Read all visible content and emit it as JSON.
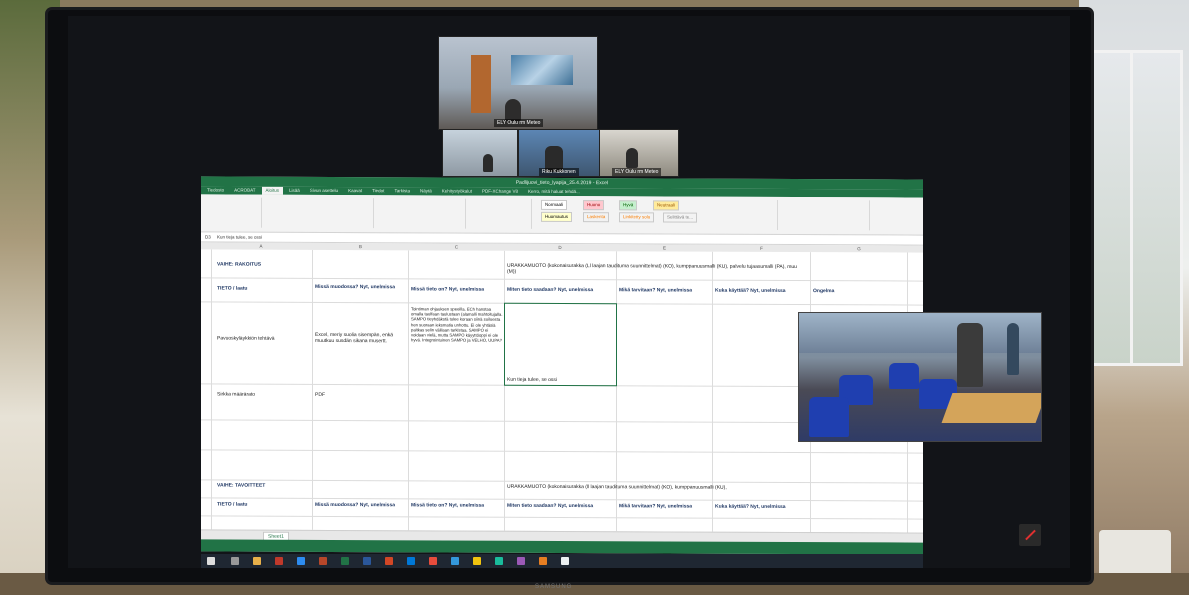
{
  "video_call": {
    "main_caption": "ELY Oulu rm Meteo",
    "tile_b_caption": "Riku Kukkonen",
    "tile_c_caption": "ELY Oulu rm Meteo"
  },
  "excel": {
    "window_title": "Padlijuovi_tieto_lyapija_25.4.2019 - Excel",
    "tabs": [
      "Tiedosto",
      "ACROBAT",
      "Aloitus",
      "Lisää",
      "Sivun asettelu",
      "Kaavat",
      "Tiedot",
      "Tarkista",
      "Näytä",
      "Kehitystyökalut",
      "PDF-XChange V8",
      "Kerro, mitä haluat tehdä..."
    ],
    "active_tab_index": 2,
    "styles": [
      "Normaali",
      "Huono",
      "Hyvä",
      "Neutraali",
      "Huomautus",
      "Laskenta",
      "Linkitetty solu",
      "Selittävä te..."
    ],
    "name_box": "D3",
    "formula": "Kun tieja tulee, se ossi",
    "columns": [
      "A",
      "B",
      "C",
      "D",
      "E",
      "F",
      "G"
    ],
    "section1_title": "VAIHE: RAKOITUS",
    "section1_note": "URAKKAMUOTO (kokonaisurakka (Ll laajan taudituma suunnittelmat) (KO), kumppanuusmalli (KU), palvelu tujaasumalli (PA), muu (M))",
    "headers": [
      "TIETO / laatu",
      "Missä muodossa? Nyt, unelmissa",
      "Missä tieto on? Nyt, unelmissa",
      "Miten tieto saadaan? Nyt, unelmissa",
      "Mikä tarvitaan? Nyt, unelmissa",
      "Kuka käyttää? Nyt, unelmissa",
      "Ongelma"
    ],
    "row3_a": "Pavuoskyläykkiön tehtävä",
    "row3_b": "Excel, meriy suolia sisempän, enkä muutkuu susdän sikana musertt.",
    "row3_c": "Tointiman ohjauksen speeilla. ECh hanstaa omalla taulfaan taulustaan (alamalli mahtoitujalla. SAMPO tieyhdäkstä tulee koraan siinä suiluesta hen suoraan ieksmatia unhottu. Ei ole yhtäsiä paltkas selin välilaan tarkistaa. SAMPO ei voidaan vielä, mutta SAMPO käyyttöoppi ei ole hyvä. Integrointuinen SAMPO ja VELHO, UUPA?",
    "row3_d": "Kun tieja tulee, se ossi",
    "row4_a": "Sirkka määrärato",
    "row4_b": "PDF",
    "section2_title": "VAIHE: TAVOITTEET",
    "section2_note": "URAKKAMUOTO (kokonaisurakka (ll laajan taudituma suunnittelmat) (KO), kumppanuusmalli (KU),",
    "headers2": [
      "TIETO / laatu",
      "Missä muodossa? Nyt, unelmissa",
      "Missä tieto on? Nyt, unelmissa",
      "Miten tieto saadaan? Nyt, unelmissa",
      "Mikä tarvitaan? Nyt, unelmissa",
      "Kuka käyttää? Nyt, unelmissa"
    ],
    "sheet_tab": "Sheet1"
  },
  "monitor_brand": "SAMSUNG",
  "colors": {
    "excel_green": "#217346",
    "chair_blue": "#1f3fb0"
  }
}
